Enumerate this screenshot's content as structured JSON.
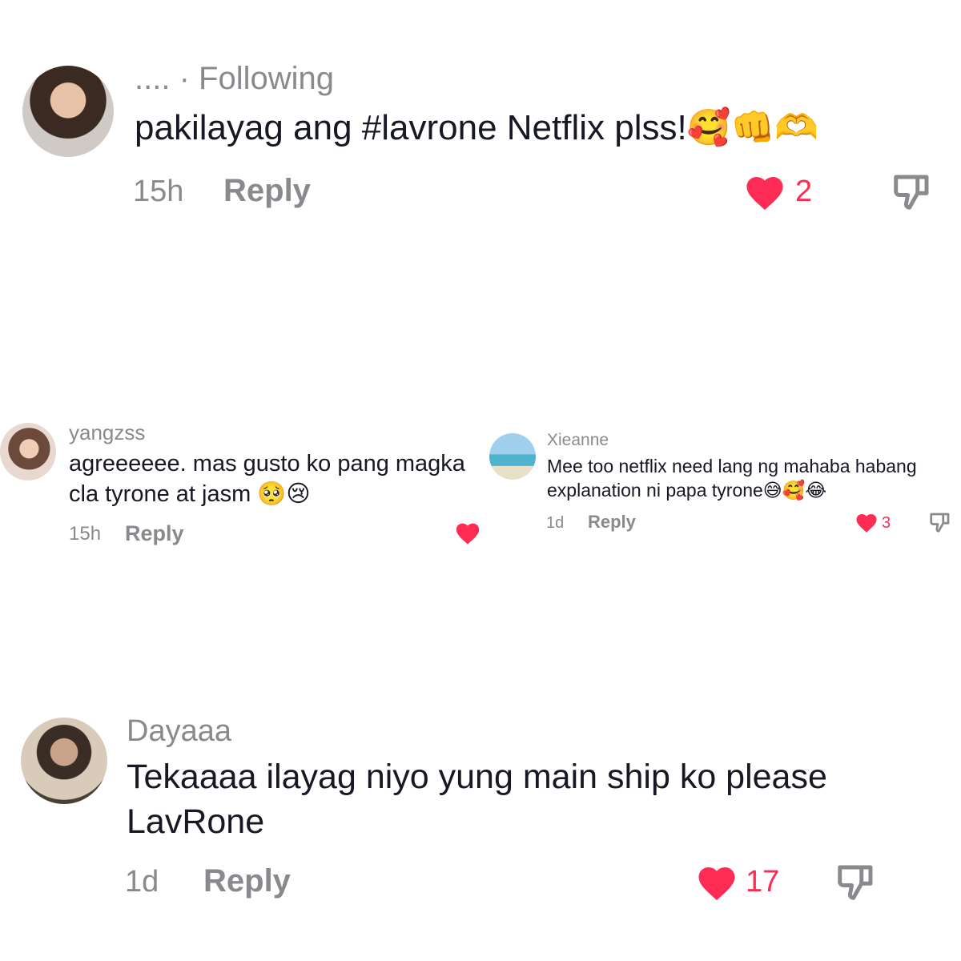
{
  "colors": {
    "like": "#fe2c55",
    "muted": "#8a8a8e",
    "text": "#161823"
  },
  "comments": [
    {
      "username": "....",
      "follow_status": "· Following",
      "text": "pakilayag ang #lavrone Netflix plss!🥰👊🫶",
      "time": "15h",
      "reply_label": "Reply",
      "likes": "2",
      "icons": [
        "avatar",
        "heart-icon",
        "dislike-icon"
      ]
    },
    {
      "username": "yangzss",
      "text_lines": [
        "agreeeeee. mas gusto ko pang magka",
        "cla tyrone at jasm 🥺😢"
      ],
      "time": "15h",
      "reply_label": "Reply",
      "icons": [
        "avatar",
        "heart-icon"
      ]
    },
    {
      "username": "Xieanne",
      "text_lines": [
        "Mee too netflix need lang ng mahaba habang",
        "explanation ni papa tyrone😅🥰😂"
      ],
      "time": "1d",
      "reply_label": "Reply",
      "likes": "3",
      "icons": [
        "avatar",
        "heart-icon",
        "dislike-icon"
      ]
    },
    {
      "username": "Dayaaa",
      "text_lines": [
        "Tekaaaa ilayag niyo yung main ship ko please",
        "LavRone"
      ],
      "time": "1d",
      "reply_label": "Reply",
      "likes": "17",
      "icons": [
        "avatar",
        "heart-icon",
        "dislike-icon"
      ]
    }
  ]
}
